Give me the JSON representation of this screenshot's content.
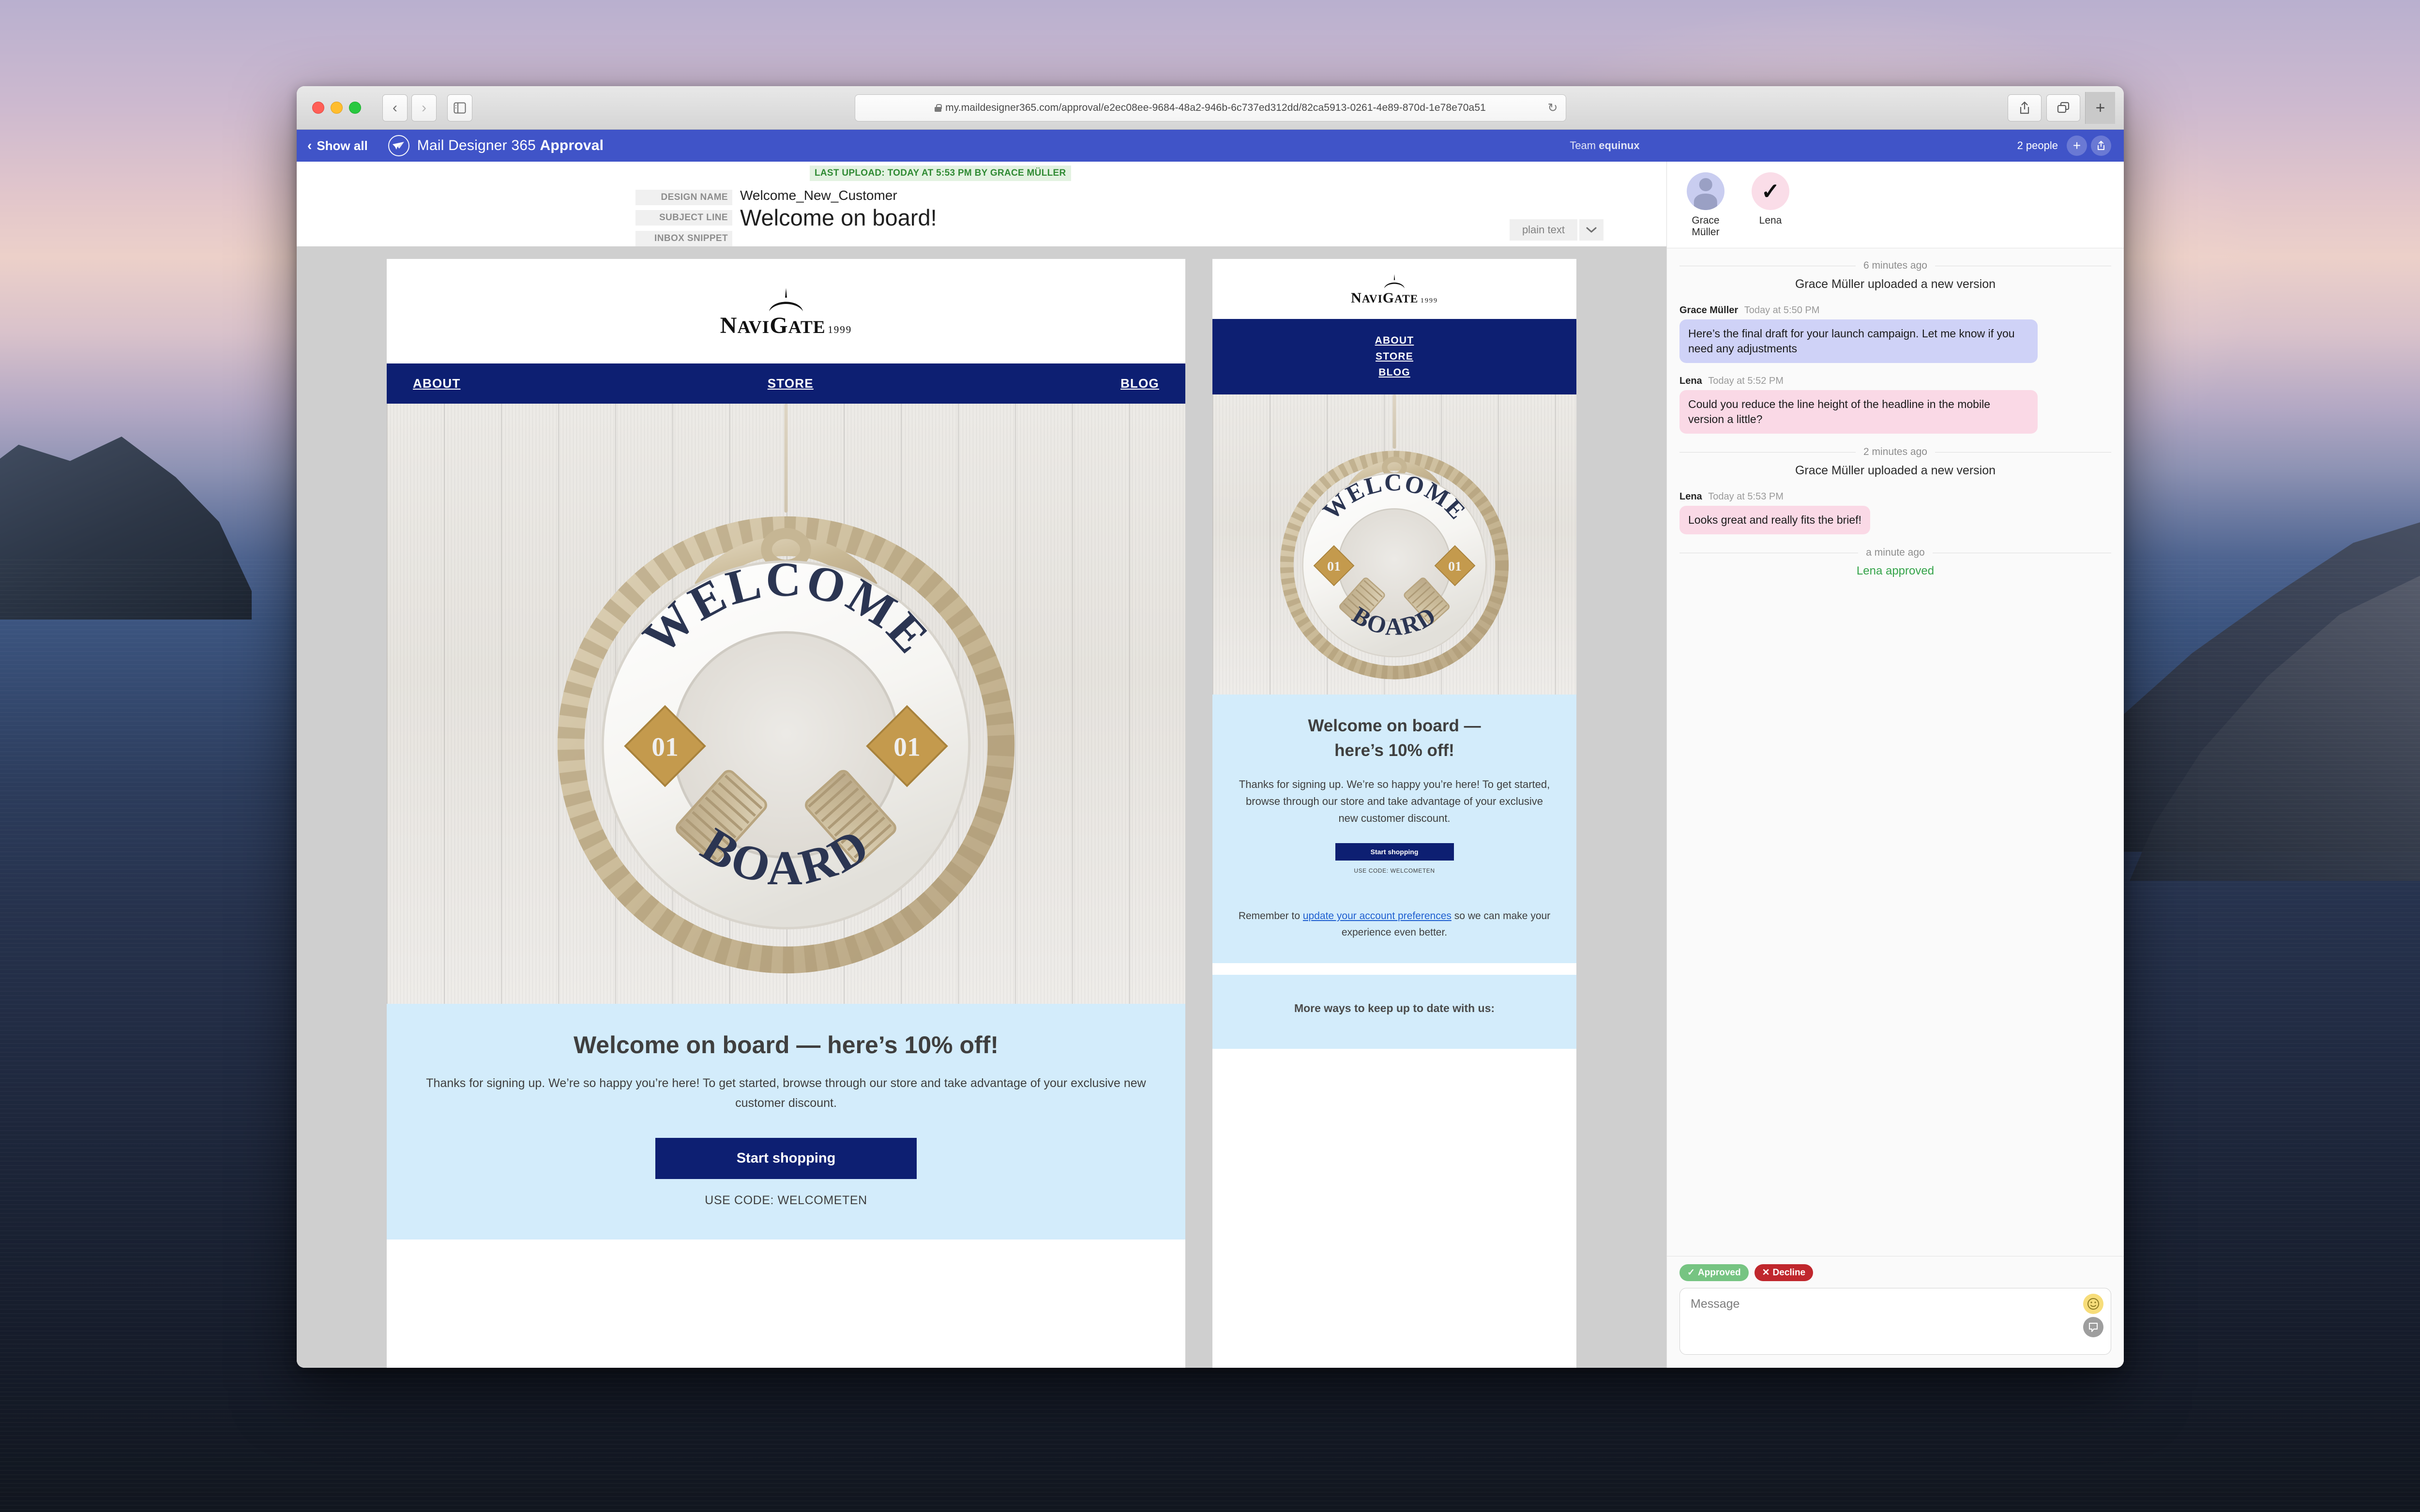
{
  "browser": {
    "url": "my.maildesigner365.com/approval/e2ec08ee-9684-48a2-946b-6c737ed312dd/82ca5913-0261-4e89-870d-1e78e70a51",
    "lock_icon": "lock-icon",
    "back_icon": "‹",
    "forward_icon": "›",
    "sidebar_icon": "sidebar-icon",
    "reload_icon": "↻",
    "share_icon": "share-icon",
    "tabs_icon": "tab-overview-icon",
    "newtab_icon": "+"
  },
  "appheader": {
    "show_all": "Show all",
    "back_chevron": "‹",
    "logo_icon": "mail-designer-bird-icon",
    "title_light": "Mail Designer 365",
    "title_bold": "Approval",
    "team_prefix": "Team",
    "team_name": "equinux",
    "people_count": "2 people",
    "add_person_icon": "+",
    "share_icon": "share-icon"
  },
  "meta": {
    "last_upload": "LAST UPLOAD: TODAY AT 5:53 PM BY GRACE MÜLLER",
    "design_name_label": "DESIGN NAME",
    "design_name_value": "Welcome_New_Customer",
    "subject_line_label": "SUBJECT LINE",
    "subject_line_value": "Welcome on board!",
    "inbox_snippet_label": "INBOX SNIPPET",
    "inbox_snippet_value": "",
    "view_mode": "plain text",
    "view_mode_chevron": "⌄"
  },
  "email": {
    "brand": "NaviGate",
    "brand_prefix": "N",
    "brand_mid": "avi",
    "brand_g": "G",
    "brand_suffix": "ate",
    "year": "1999",
    "nav": [
      "ABOUT",
      "STORE",
      "BLOG"
    ],
    "hero_alt": "life-ring-welcome-board-photo",
    "ring_top_text": "WELCOME",
    "ring_bottom_text": "BOARD",
    "ring_badge": "01",
    "headline_desktop": "Welcome on board — here’s 10% off!",
    "headline_mobile_line1": "Welcome on board —",
    "headline_mobile_line2": "here’s 10% off!",
    "body": "Thanks for signing up. We’re so happy you’re here! To get started, browse through our store and take advantage of your exclusive new customer discount.",
    "cta": "Start shopping",
    "promo": "USE CODE: WELCOMETEN",
    "prefs_before": "Remember to ",
    "prefs_link": "update your account preferences",
    "prefs_after": " so we can make your experience even better.",
    "more_ways": "More ways to keep up to date with us:"
  },
  "chat": {
    "people": [
      {
        "name": "Grace Müller",
        "avatar": "user-silhouette-icon"
      },
      {
        "name": "Lena",
        "avatar": "checkmark-icon"
      }
    ],
    "timeline": [
      {
        "kind": "divider",
        "label": "6 minutes ago"
      },
      {
        "kind": "system",
        "text": "Grace Müller uploaded a new version"
      },
      {
        "kind": "message",
        "who": "Grace Müller",
        "when": "Today at 5:50 PM",
        "side": "grace",
        "text": "Here’s the final draft for your launch campaign. Let me know if you need any adjustments"
      },
      {
        "kind": "message",
        "who": "Lena",
        "when": "Today at 5:52 PM",
        "side": "lena",
        "text": "Could you reduce the line height of the headline in the mobile version a little?"
      },
      {
        "kind": "divider",
        "label": "2 minutes ago"
      },
      {
        "kind": "system",
        "text": "Grace Müller uploaded a new version"
      },
      {
        "kind": "message",
        "who": "Lena",
        "when": "Today at 5:53 PM",
        "side": "lena",
        "text": "Looks great and really fits the brief!"
      },
      {
        "kind": "divider",
        "label": "a minute ago"
      },
      {
        "kind": "approved",
        "text": "Lena approved"
      }
    ],
    "approved_button": "Approved",
    "approved_icon": "✓",
    "decline_button": "Decline",
    "decline_icon": "✕",
    "message_placeholder": "Message",
    "emoji_icon": "smiley-icon",
    "comment_icon": "comment-bubble-icon"
  },
  "colors": {
    "app_header": "#4054c8",
    "email_navy": "#0d1f72",
    "email_light_blue": "#d3ecfb",
    "approved_green": "#35a44a",
    "decline_red": "#c0272d"
  }
}
